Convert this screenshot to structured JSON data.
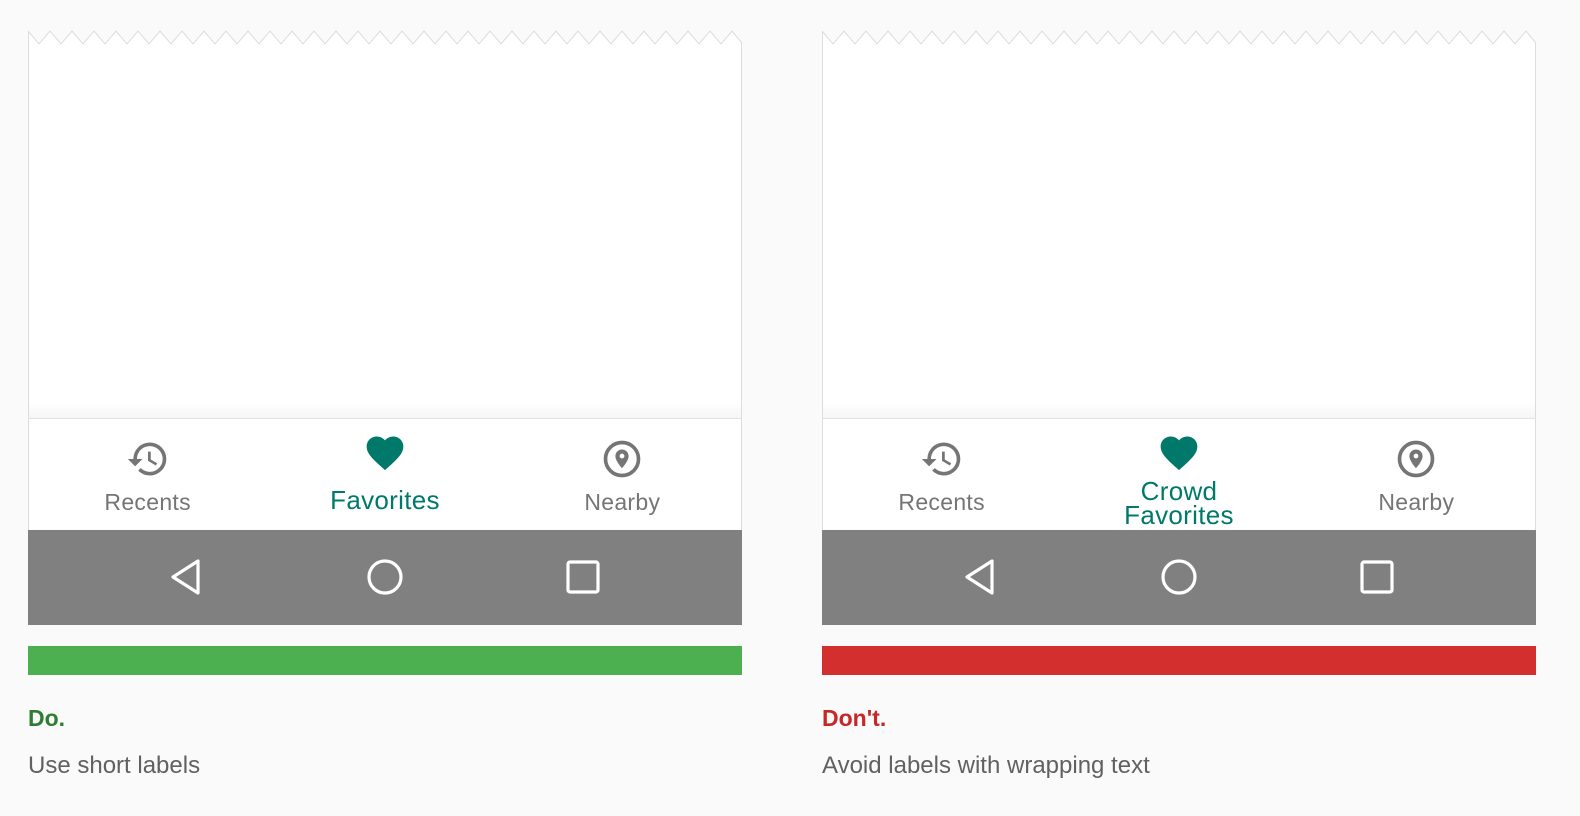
{
  "colors": {
    "active": "#00796b",
    "inactive": "#757575",
    "system_bar": "#808080",
    "do": "#4caf50",
    "do_text": "#2e7d32",
    "dont": "#d32f2f",
    "dont_text": "#c62828"
  },
  "panels": [
    {
      "nav": [
        {
          "label": "Recents",
          "icon": "history-icon",
          "active": false
        },
        {
          "label": "Favorites",
          "icon": "heart-icon",
          "active": true
        },
        {
          "label": "Nearby",
          "icon": "place-icon",
          "active": false
        }
      ],
      "status": "do",
      "caption_title": "Do.",
      "caption_text": "Use short labels"
    },
    {
      "nav": [
        {
          "label": "Recents",
          "icon": "history-icon",
          "active": false
        },
        {
          "label": "Crowd\nFavorites",
          "icon": "heart-icon",
          "active": true
        },
        {
          "label": "Nearby",
          "icon": "place-icon",
          "active": false
        }
      ],
      "status": "dont",
      "caption_title": "Don't.",
      "caption_text": "Avoid labels with wrapping text"
    }
  ],
  "system_nav": [
    "back-icon",
    "home-icon",
    "recent-apps-icon"
  ]
}
